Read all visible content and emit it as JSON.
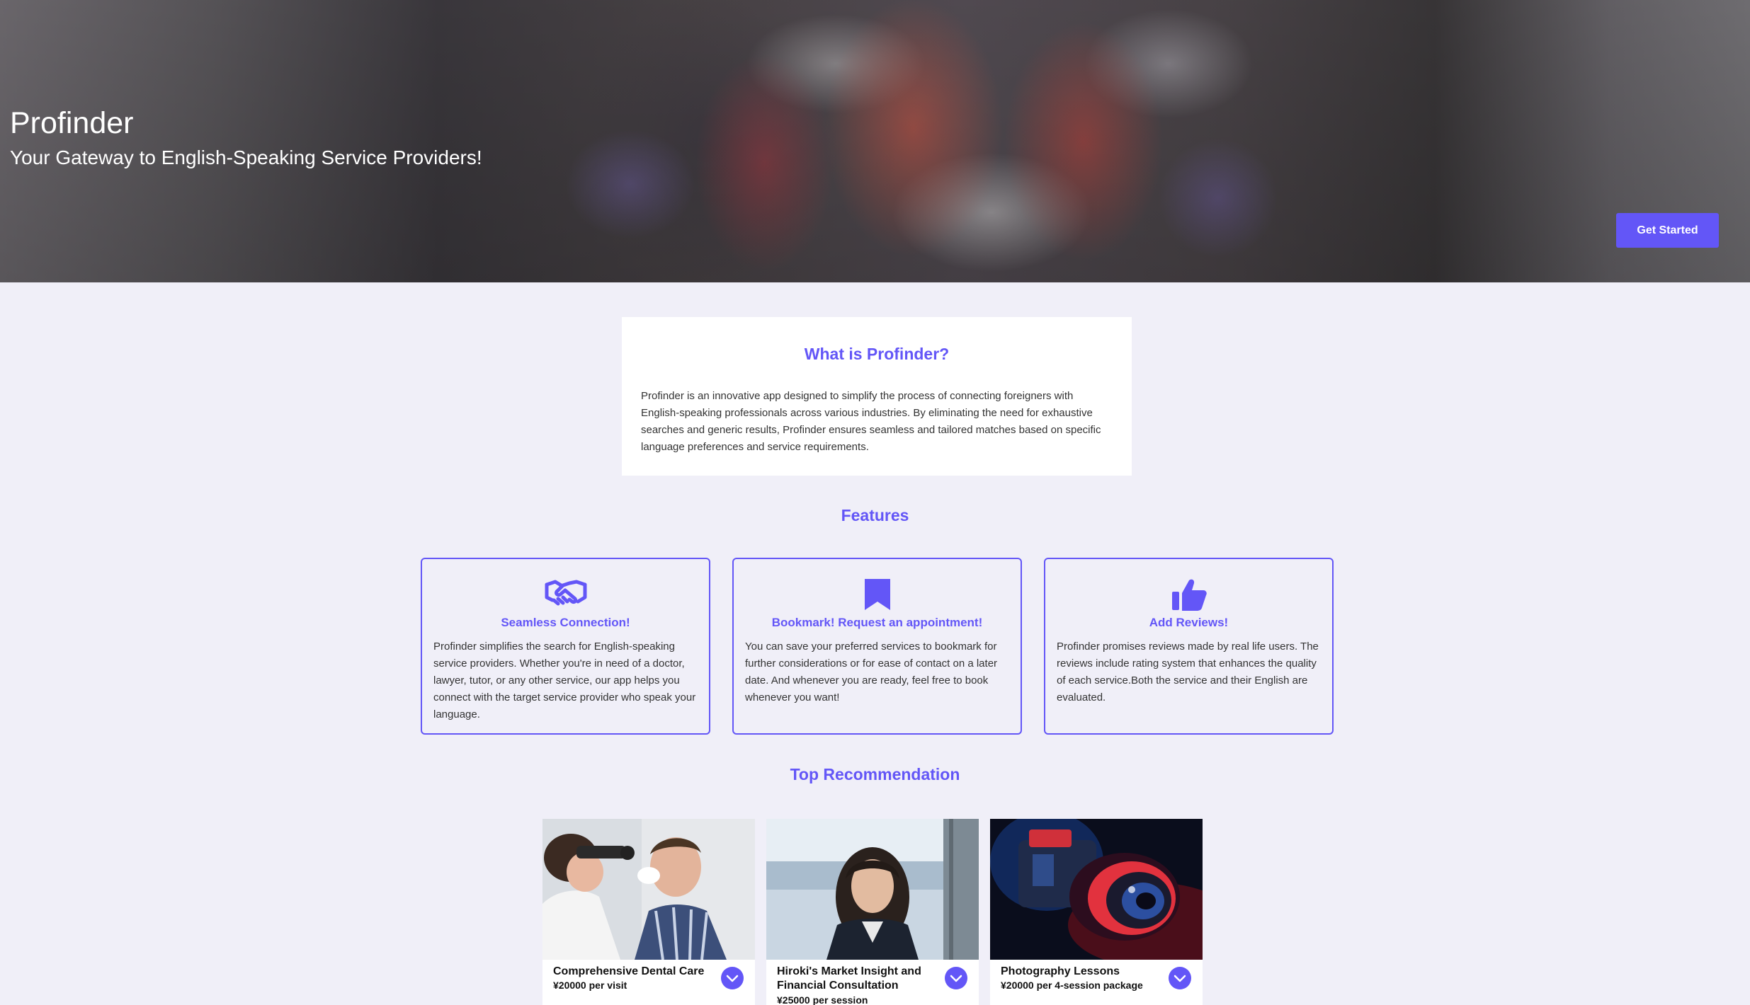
{
  "hero": {
    "title": "Profinder",
    "subtitle": "Your Gateway to English-Speaking Service Providers!",
    "cta_label": "Get Started"
  },
  "about": {
    "heading": "What is Profinder?",
    "body": "Profinder is an innovative app designed to simplify the process of connecting foreigners with English-speaking professionals across various industries. By eliminating the need for exhaustive searches and generic results, Profinder ensures seamless and tailored matches based on specific language preferences and service requirements."
  },
  "features": {
    "heading": "Features",
    "items": [
      {
        "icon": "handshake-icon",
        "title": "Seamless Connection!",
        "body": "Profinder simplifies the search for English-speaking service providers. Whether you're in need of a doctor, lawyer, tutor, or any other service, our app helps you connect with the target service provider who speak your language."
      },
      {
        "icon": "bookmark-icon",
        "title": "Bookmark! Request an appointment!",
        "body": "You can save your preferred services to bookmark for further considerations or for ease of contact on a later date. And whenever you are ready, feel free to book whenever you want!"
      },
      {
        "icon": "thumbs-up-icon",
        "title": "Add Reviews!",
        "body": "Profinder promises reviews made by real life users. The reviews include rating system that enhances the quality of each service.Both the service and their English are evaluated."
      }
    ]
  },
  "recommendations": {
    "heading": "Top Recommendation",
    "items": [
      {
        "title": "Comprehensive Dental Care",
        "price": "¥20000 per visit"
      },
      {
        "title": "Hiroki's Market Insight and Financial Consultation",
        "price": "¥25000 per session"
      },
      {
        "title": "Photography Lessons",
        "price": "¥20000 per 4-session package"
      }
    ]
  },
  "colors": {
    "accent": "#6356f7",
    "page_background": "#f0eff8",
    "card_background": "#ffffff"
  }
}
